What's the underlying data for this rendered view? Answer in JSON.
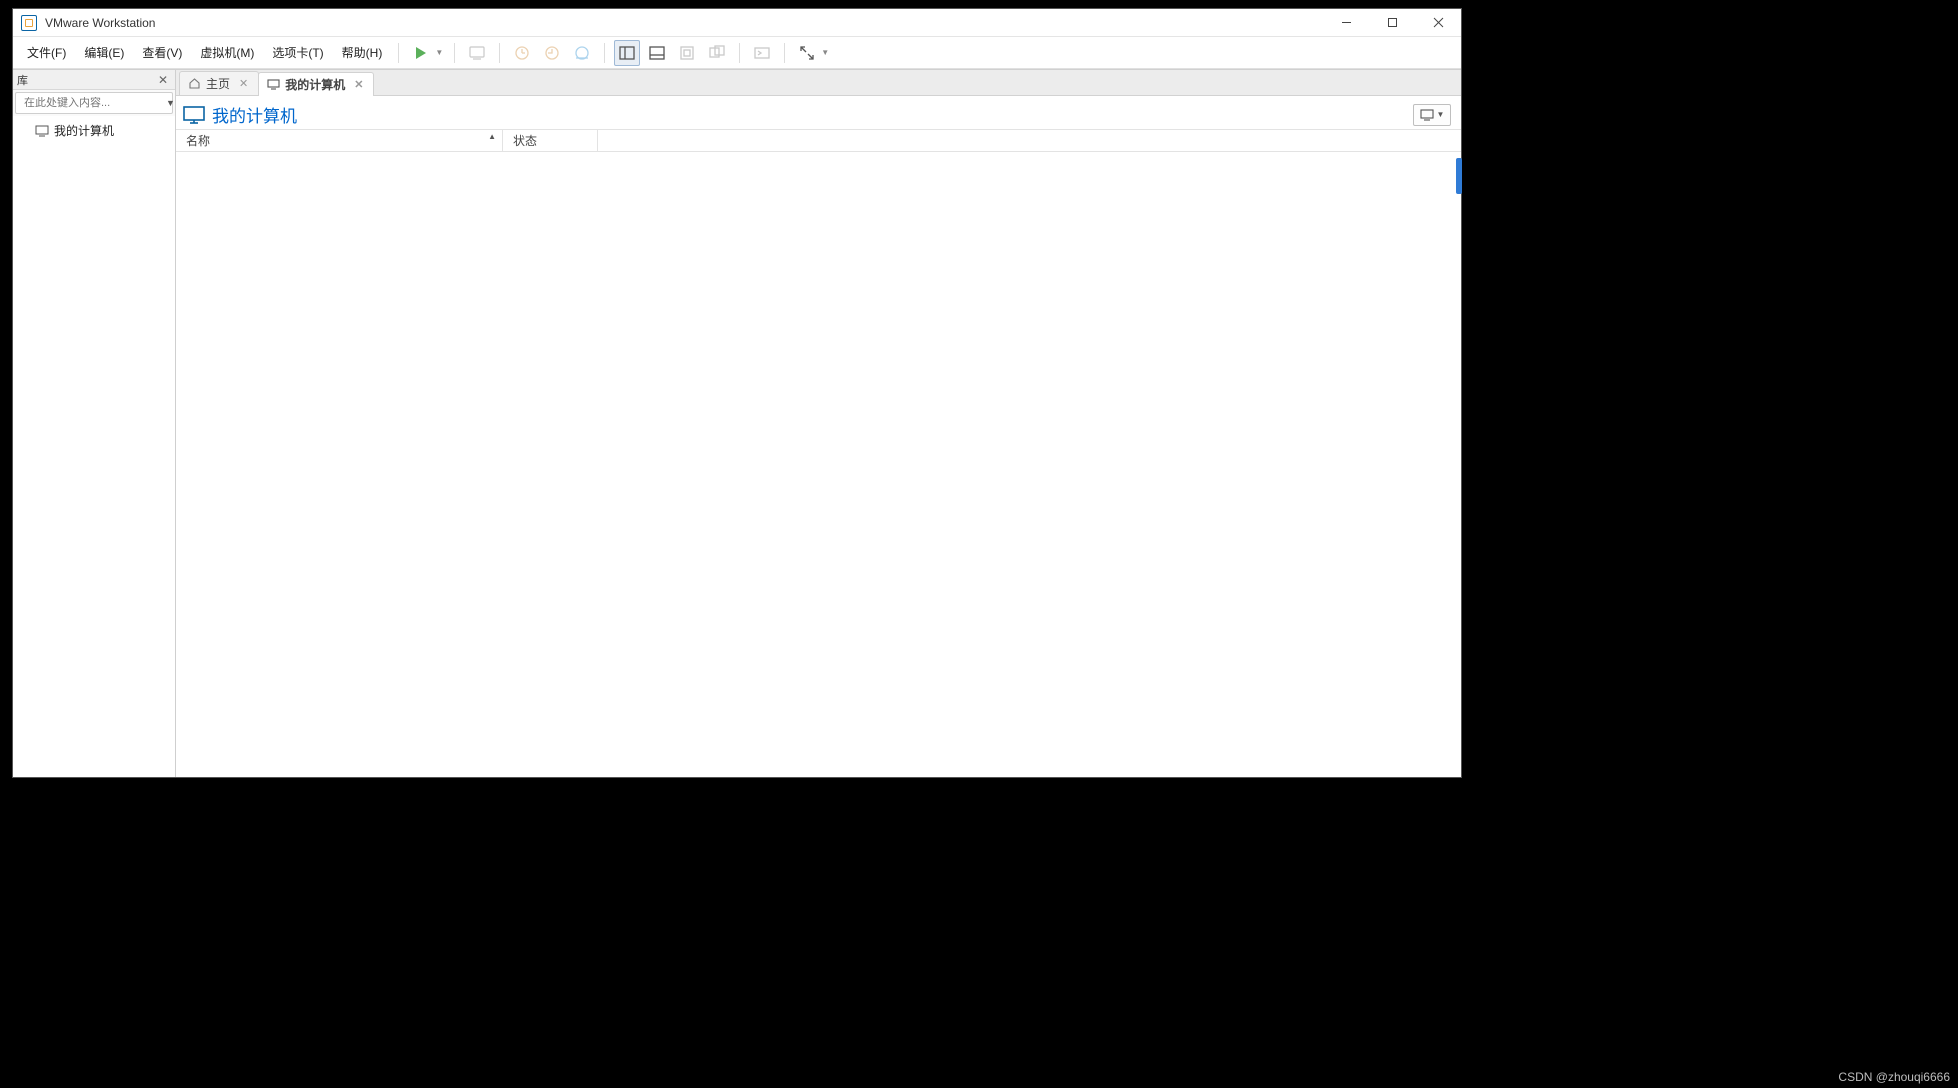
{
  "window": {
    "title": "VMware Workstation"
  },
  "menu": {
    "file": "文件(F)",
    "edit": "编辑(E)",
    "view": "查看(V)",
    "vm": "虚拟机(M)",
    "tabs": "选项卡(T)",
    "help": "帮助(H)"
  },
  "sidebar": {
    "header": "库",
    "search_placeholder": "在此处键入内容...",
    "tree": {
      "my_computer": "我的计算机"
    }
  },
  "tabs": [
    {
      "id": "home",
      "label": "主页",
      "active": false
    },
    {
      "id": "mycomputer",
      "label": "我的计算机",
      "active": true
    }
  ],
  "content": {
    "title": "我的计算机",
    "columns": {
      "name": "名称",
      "state": "状态"
    }
  },
  "watermark": "CSDN @zhouqi6666"
}
